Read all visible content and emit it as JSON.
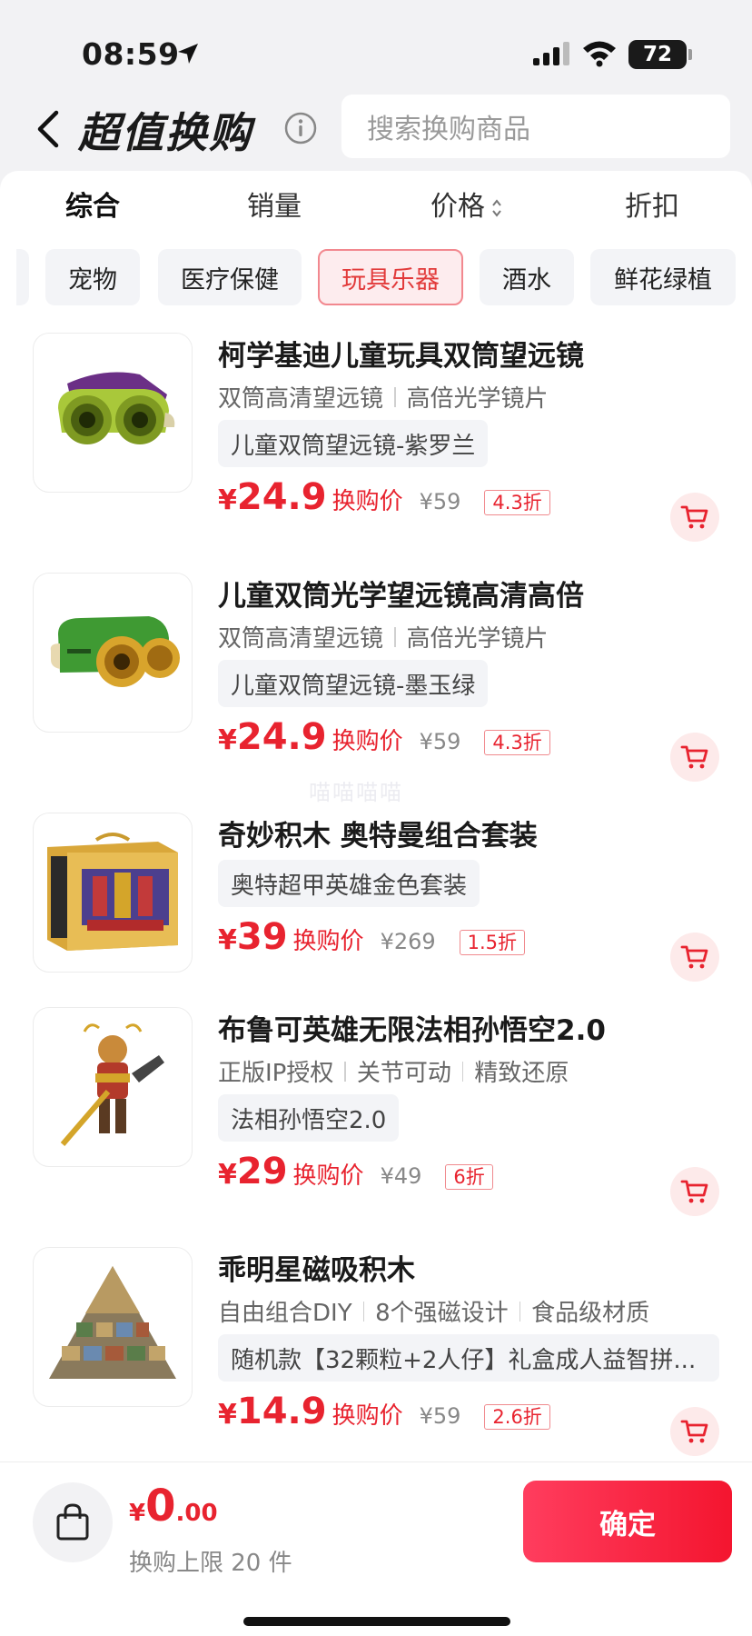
{
  "status": {
    "time": "08:59",
    "battery": "72"
  },
  "header": {
    "title": "超值换购",
    "search_placeholder": "搜索换购商品"
  },
  "sort": {
    "items": [
      "综合",
      "销量",
      "价格",
      "折扣"
    ]
  },
  "categories": [
    "宠物",
    "医疗保健",
    "玩具乐器",
    "酒水",
    "鲜花绿植"
  ],
  "active_category": "玩具乐器",
  "products": [
    {
      "title": "柯学基迪儿童玩具双筒望远镜",
      "features": [
        "双筒高清望远镜",
        "高倍光学镜片"
      ],
      "variant": "儿童双筒望远镜-紫罗兰",
      "currency": "¥",
      "price": "24.9",
      "price_label": "换购价",
      "original_price": "¥59",
      "discount": "4.3折"
    },
    {
      "title": "儿童双筒光学望远镜高清高倍",
      "features": [
        "双筒高清望远镜",
        "高倍光学镜片"
      ],
      "variant": "儿童双筒望远镜-墨玉绿",
      "currency": "¥",
      "price": "24.9",
      "price_label": "换购价",
      "original_price": "¥59",
      "discount": "4.3折"
    },
    {
      "title": "奇妙积木 奥特曼组合套装",
      "features": [],
      "variant": "奥特超甲英雄金色套装",
      "currency": "¥",
      "price": "39",
      "price_label": "换购价",
      "original_price": "¥269",
      "discount": "1.5折"
    },
    {
      "title": "布鲁可英雄无限法相孙悟空2.0",
      "features": [
        "正版IP授权",
        "关节可动",
        "精致还原"
      ],
      "variant": "法相孙悟空2.0",
      "currency": "¥",
      "price": "29",
      "price_label": "换购价",
      "original_price": "¥49",
      "discount": "6折"
    },
    {
      "title": "乖明星磁吸积木",
      "features": [
        "自由组合DIY",
        "8个强磁设计",
        "食品级材质"
      ],
      "variant": "随机款【32颗粒+2人仔】礼盒成人益智拼...",
      "currency": "¥",
      "price": "14.9",
      "price_label": "换购价",
      "original_price": "¥59",
      "discount": "2.6折"
    }
  ],
  "watermark": "喵喵喵喵",
  "footer": {
    "currency": "¥",
    "total_int": "0",
    "total_dec": ".00",
    "limit_text": "换购上限 20 件",
    "confirm_label": "确定"
  },
  "colors": {
    "accent": "#e8232f",
    "button": "#f4152f"
  }
}
